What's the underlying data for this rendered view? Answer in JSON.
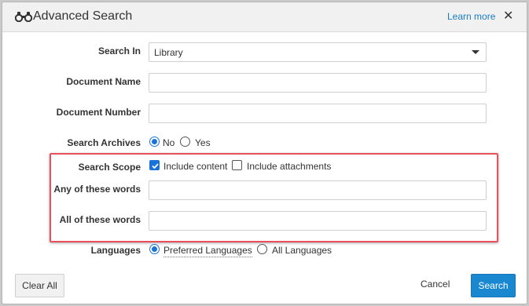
{
  "dialog": {
    "title": "Advanced Search",
    "icon": "binoculars-icon",
    "learn_more": "Learn more",
    "close_glyph": "✕"
  },
  "form": {
    "search_in": {
      "label": "Search In",
      "value": "Library"
    },
    "document_name": {
      "label": "Document Name",
      "value": ""
    },
    "document_number": {
      "label": "Document Number",
      "value": ""
    },
    "search_archives": {
      "label": "Search Archives",
      "options": [
        {
          "label": "No",
          "selected": true
        },
        {
          "label": "Yes",
          "selected": false
        }
      ]
    },
    "search_scope": {
      "label": "Search Scope",
      "options": [
        {
          "label": "Include content",
          "checked": true
        },
        {
          "label": "Include attachments",
          "checked": false
        }
      ]
    },
    "any_words": {
      "label": "Any of these words",
      "value": ""
    },
    "all_words": {
      "label": "All of these words",
      "value": ""
    },
    "languages": {
      "label": "Languages",
      "options": [
        {
          "label": "Preferred Languages",
          "selected": true
        },
        {
          "label": "All Languages",
          "selected": false
        }
      ]
    }
  },
  "footer": {
    "clear_all": "Clear All",
    "cancel": "Cancel",
    "search": "Search"
  },
  "colors": {
    "accent": "#1a87d1",
    "highlight_border": "#e8515a",
    "link": "#1a7cc1"
  }
}
